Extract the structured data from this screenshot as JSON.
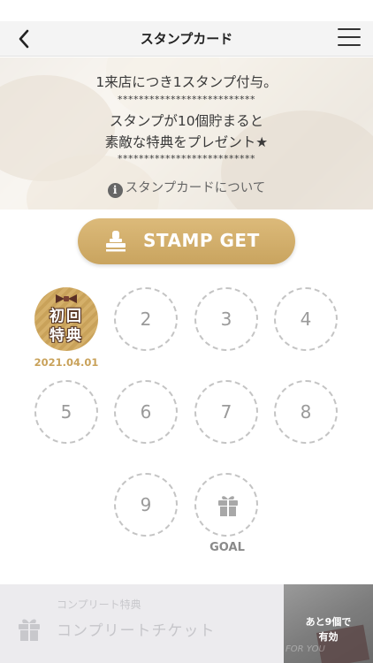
{
  "nav": {
    "title": "スタンプカード",
    "back_icon": "chevron-left-icon",
    "menu_icon": "hamburger-menu-icon"
  },
  "hero": {
    "line1": "1来店につき1スタンプ付与。",
    "stars1": "**************************",
    "line2": "スタンプが10個貯まると",
    "line3": "素敵な特典をプレゼント★",
    "stars2": "**************************",
    "about_icon": "i",
    "about_label": "スタンプカードについて"
  },
  "stamp_button": {
    "label": "STAMP GET",
    "icon": "stamp-icon"
  },
  "stamps": {
    "first": {
      "line1": "初回",
      "line2": "特典",
      "date": "2021.04.01"
    },
    "slots": [
      "2",
      "3",
      "4",
      "5",
      "6",
      "7",
      "8",
      "9"
    ],
    "goal_label": "GOAL"
  },
  "footer": {
    "sub_label": "コンプリート特典",
    "main_label": "コンプリートチケット",
    "thumb_line1": "あと9個で",
    "thumb_line2": "有効",
    "thumb_bg": "FOR YOU"
  },
  "colors": {
    "accent_gold": "#c9a45f",
    "slot_border": "#c4c4c4",
    "footer_bg": "#ecebee"
  }
}
